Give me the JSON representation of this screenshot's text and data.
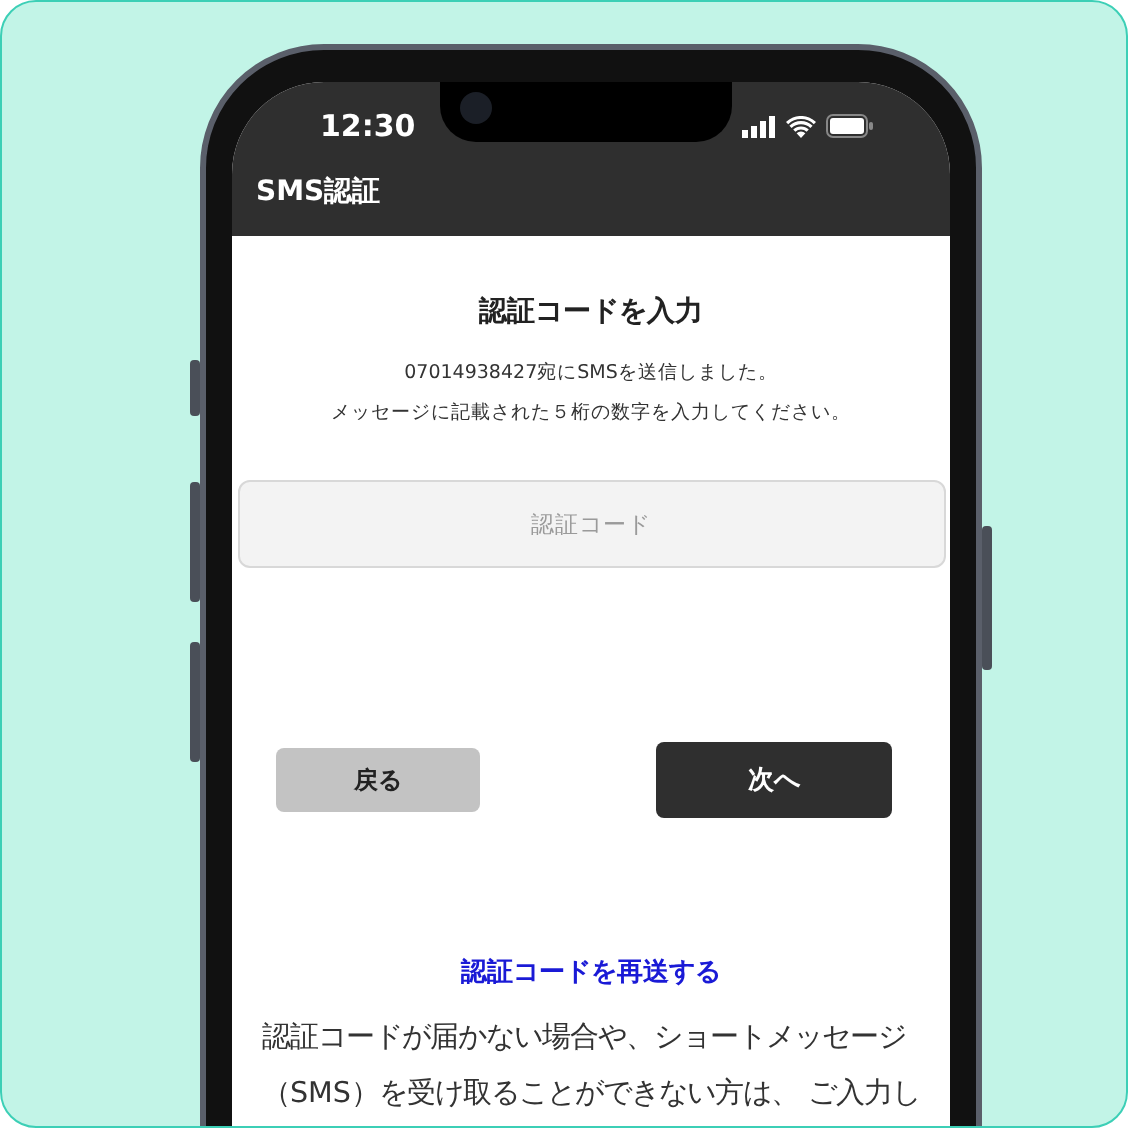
{
  "status_bar": {
    "time": "12:30"
  },
  "header": {
    "title": "SMS認証"
  },
  "title": "認証コードを入力",
  "message_lines": [
    "07014938427宛にSMSを送信しました。",
    "メッセージに記載された５桁の数字を入力してください。"
  ],
  "code_field": {
    "placeholder": "認証コード"
  },
  "buttons": [
    {
      "label": "戻る",
      "kind": "secondary"
    },
    {
      "label": "次へ",
      "kind": "primary"
    }
  ],
  "resend_link": "認証コードを再送する",
  "help_text_lines": [
    "認証コードが届かない場合や、ショートメッセージ",
    "（SMS）を受け取ることができない方は、 ご入力し"
  ]
}
